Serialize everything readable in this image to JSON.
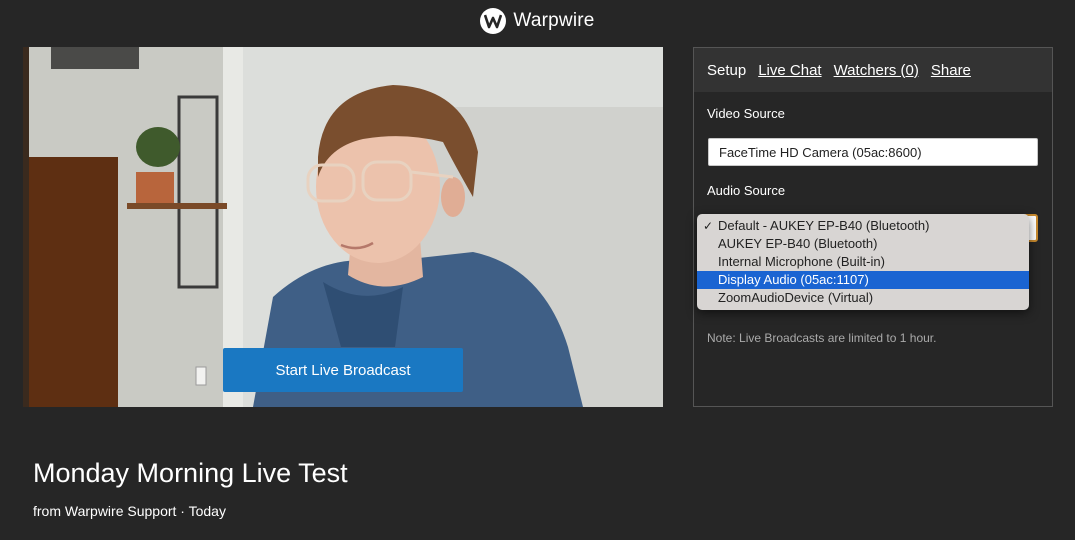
{
  "brand": {
    "name": "Warpwire",
    "logo_letter": "W"
  },
  "broadcast": {
    "start_label": "Start Live Broadcast"
  },
  "panel": {
    "tabs": [
      {
        "label": "Setup",
        "link": false
      },
      {
        "label": "Live Chat",
        "link": true
      },
      {
        "label": "Watchers (0)",
        "link": true
      },
      {
        "label": "Share",
        "link": true
      }
    ],
    "video_source_label": "Video Source",
    "video_source_value": "FaceTime HD Camera (05ac:8600)",
    "audio_source_label": "Audio Source",
    "audio_options": [
      "Default - AUKEY EP-B40 (Bluetooth)",
      "AUKEY EP-B40 (Bluetooth)",
      "Internal Microphone (Built-in)",
      "Display Audio (05ac:1107)",
      "ZoomAudioDevice (Virtual)"
    ],
    "audio_checked_index": 0,
    "audio_highlight_index": 3,
    "check_mark": "✓",
    "note": "Note: Live Broadcasts are limited to 1 hour."
  },
  "video_info": {
    "title": "Monday Morning Live Test",
    "byline": "from Warpwire Support · Today"
  },
  "colors": {
    "accent_button": "#1a78c2",
    "highlight": "#1a64d2",
    "background": "#262626"
  }
}
